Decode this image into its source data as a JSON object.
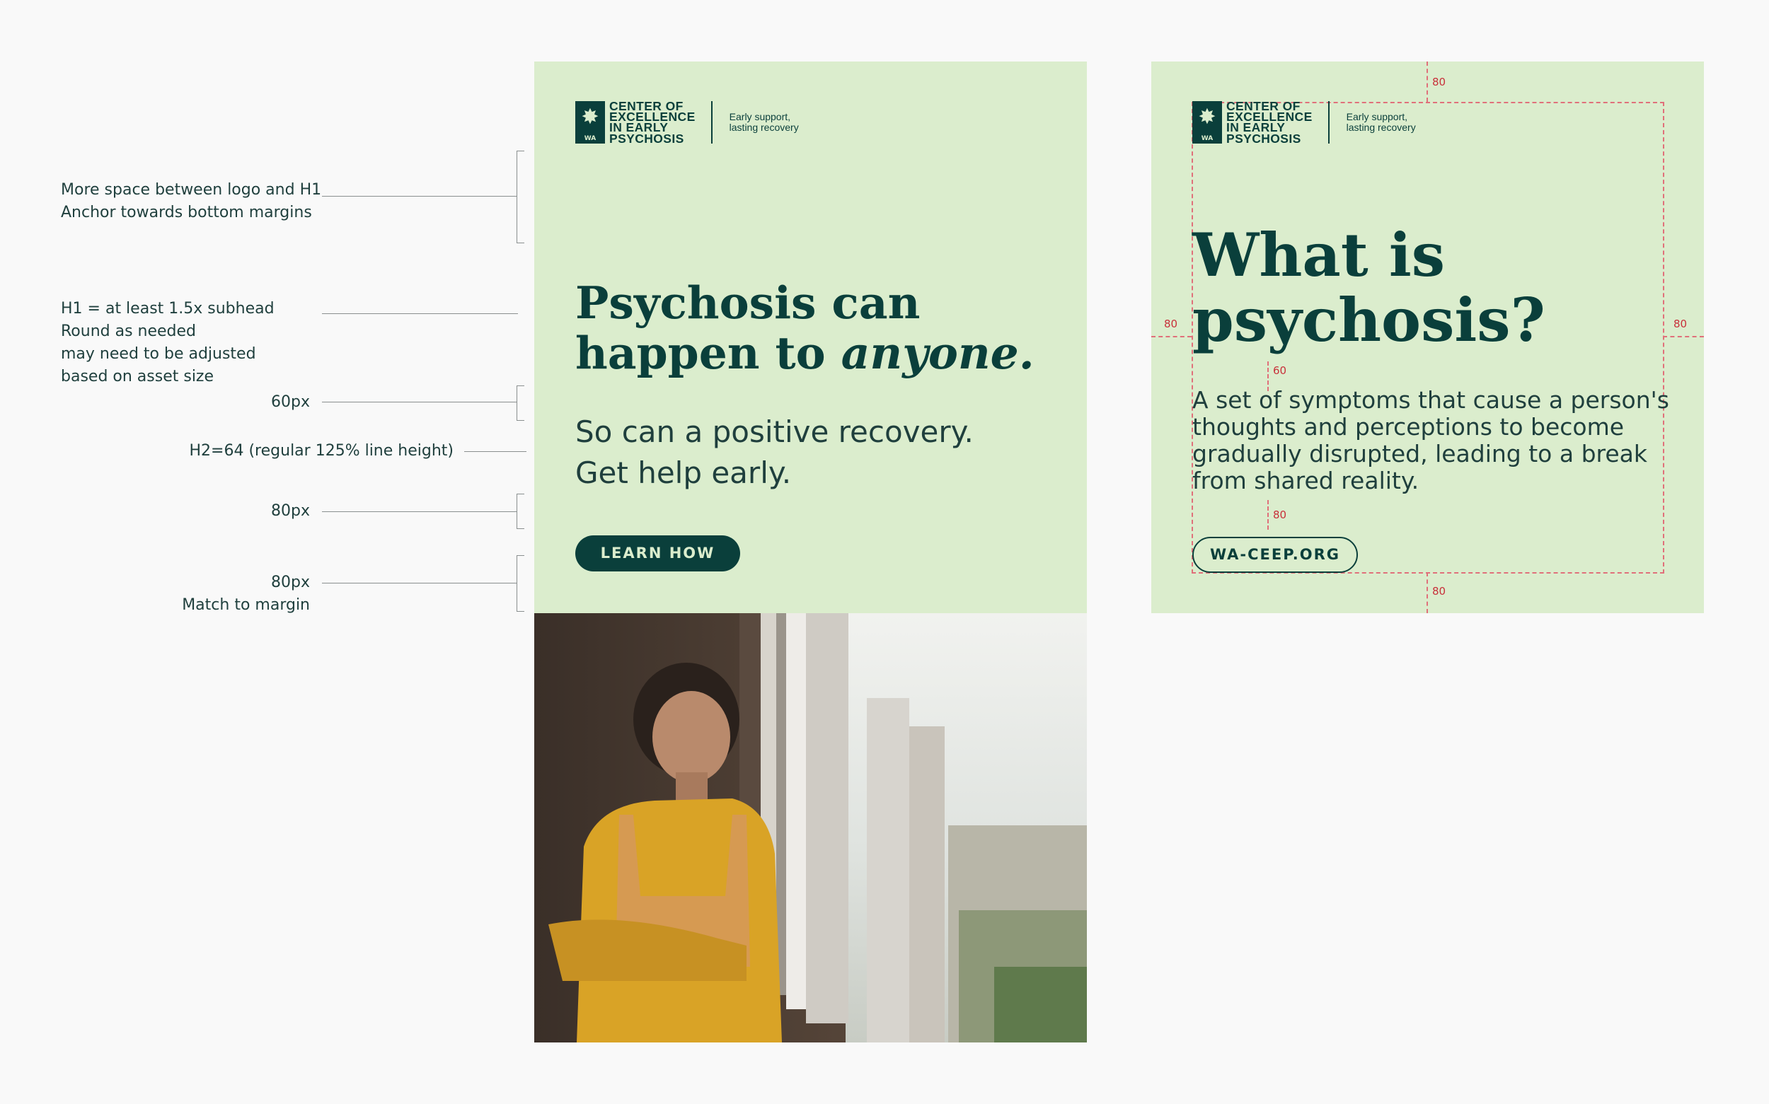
{
  "annotations": {
    "logo_spacing": [
      "More space between logo and H1",
      "Anchor towards bottom margins"
    ],
    "h1_rule": [
      "H1 = at least 1.5x subhead",
      "Round as needed",
      "may need to be adjusted",
      "based on asset size"
    ],
    "gap_60": "60px",
    "h2_rule": "H2=64 (regular 125% line height)",
    "gap_80": "80px",
    "margin_80": [
      "80px",
      "Match to margin"
    ]
  },
  "brand": {
    "name_lines": [
      "CENTER OF",
      "EXCELLENCE",
      "IN EARLY",
      "PSYCHOSIS"
    ],
    "mark_label": "WA",
    "tagline_lines": [
      "Early support,",
      "lasting recovery"
    ]
  },
  "ad_left": {
    "headline_line1": "Psychosis can",
    "headline_line2_prefix": "happen to ",
    "headline_emphasis": "anyone.",
    "subhead_lines": [
      "So can a positive recovery.",
      "Get help early."
    ],
    "button_label": "LEARN HOW"
  },
  "ad_right": {
    "headline_lines": [
      "What is",
      "psychosis?"
    ],
    "body_lines": [
      "A set of symptoms that cause a person's",
      "thoughts and perceptions to become",
      "gradually disrupted, leading to a break",
      "from shared reality."
    ],
    "button_label": "WA-CEEP.ORG",
    "guide_labels": {
      "top": "80",
      "left": "80",
      "right": "80",
      "gap_h1_body": "60",
      "gap_body_btn": "80",
      "bottom": "80"
    }
  },
  "colors": {
    "panel": "#dbedcd",
    "brand_dark": "#0a3f3b",
    "guide": "#e0707a",
    "canvas": "#f9f9f9"
  }
}
